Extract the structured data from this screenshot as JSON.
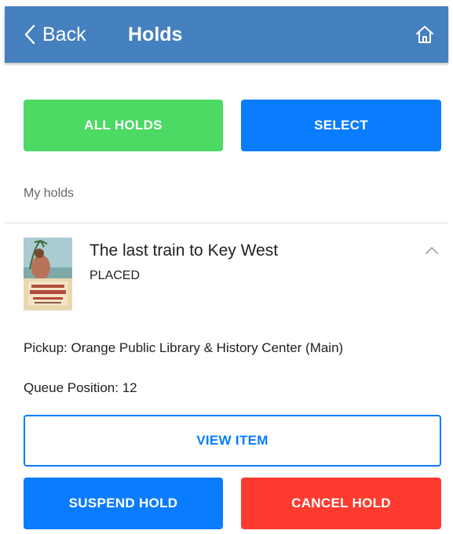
{
  "header": {
    "back_label": "Back",
    "title": "Holds",
    "back_icon": "chevron-left-icon",
    "home_icon": "home-icon",
    "background": "#4580bf"
  },
  "actions": {
    "all_holds_label": "ALL HOLDS",
    "select_label": "SELECT"
  },
  "section_label": "My holds",
  "hold": {
    "cover_icon": "book-cover-image",
    "title": "The last train to Key West",
    "status": "PLACED",
    "expand_icon": "chevron-up-icon",
    "pickup": "Pickup: Orange Public Library & History Center (Main)",
    "queue_position": "Queue Position: 12",
    "view_item_label": "VIEW ITEM",
    "suspend_label": "SUSPEND HOLD",
    "cancel_label": "CANCEL HOLD"
  },
  "colors": {
    "green": "#4cd964",
    "blue": "#0a7cff",
    "red": "#ff3b30"
  }
}
